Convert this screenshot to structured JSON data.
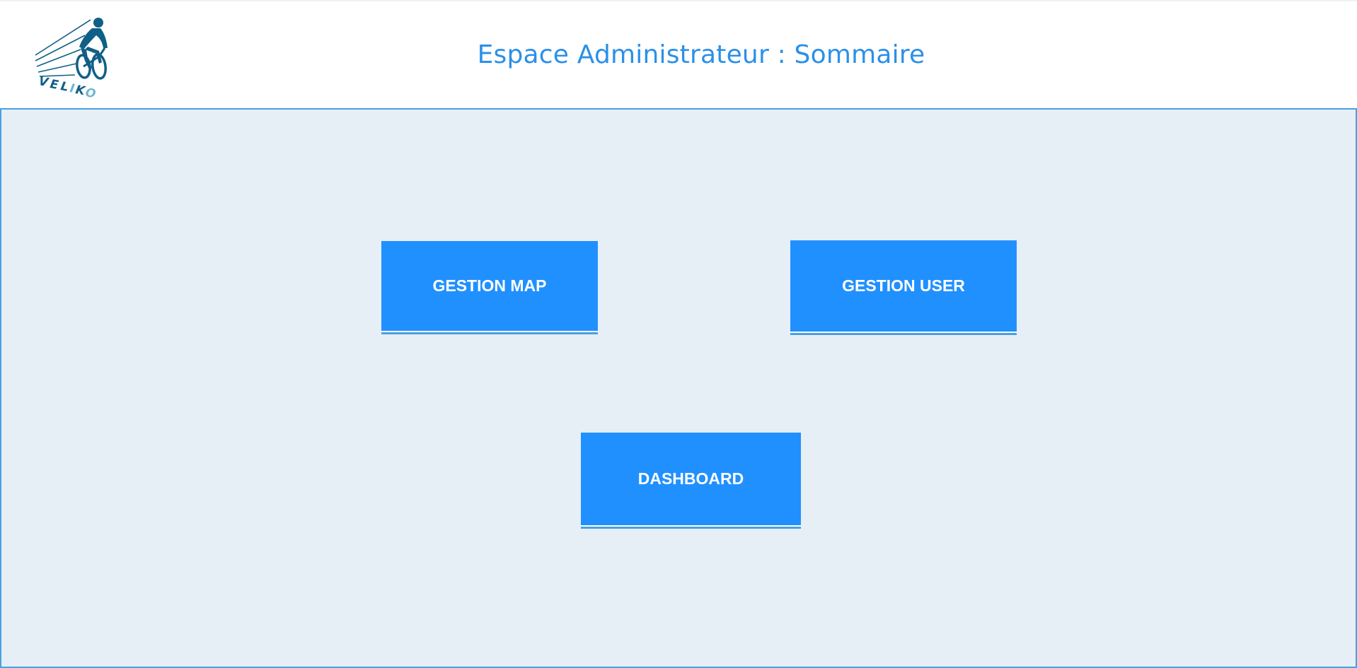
{
  "header": {
    "logo_text": "VELIKO",
    "title": "Espace Administrateur : Sommaire"
  },
  "colors": {
    "accent": "#2190ff",
    "title": "#2b90e8",
    "logo": "#0f5f86",
    "background": "#e6eff6"
  },
  "menu": {
    "gestion_map_label": "GESTION MAP",
    "gestion_user_label": "GESTION USER",
    "dashboard_label": "DASHBOARD"
  }
}
